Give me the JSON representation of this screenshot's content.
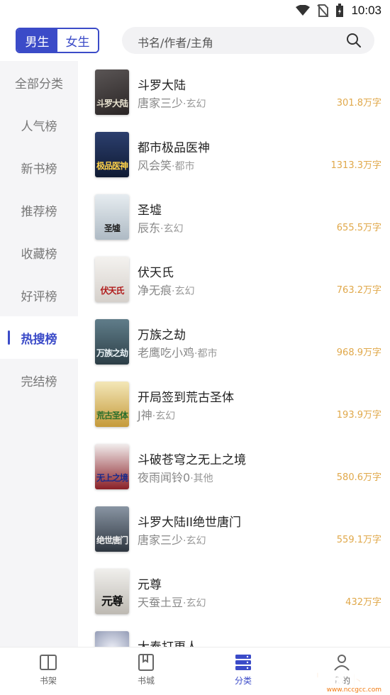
{
  "status_bar": {
    "time": "10:03",
    "icons": [
      "wifi-icon",
      "no-sim-icon",
      "battery-charging-icon"
    ]
  },
  "header": {
    "gender_tabs": [
      {
        "label": "男生",
        "active": true
      },
      {
        "label": "女生",
        "active": false
      }
    ],
    "search": {
      "placeholder": "书名/作者/主角",
      "icon": "search-icon"
    }
  },
  "sidebar": {
    "items": [
      {
        "label": "全部分类",
        "active": false
      },
      {
        "label": "人气榜",
        "active": false
      },
      {
        "label": "新书榜",
        "active": false
      },
      {
        "label": "推荐榜",
        "active": false
      },
      {
        "label": "收藏榜",
        "active": false
      },
      {
        "label": "好评榜",
        "active": false
      },
      {
        "label": "热搜榜",
        "active": true
      },
      {
        "label": "完结榜",
        "active": false
      }
    ]
  },
  "books": [
    {
      "title": "斗罗大陆",
      "author": "唐家三少",
      "sep": "·",
      "genre": "玄幻",
      "count": "301.8万字",
      "cover_text": "斗罗大陆",
      "cover_color": "#3d3a3a"
    },
    {
      "title": "都市极品医神",
      "author": "风会笑",
      "sep": "·",
      "genre": "都市",
      "count": "1313.3万字",
      "cover_text": "极品医神",
      "cover_color": "#1d2c52"
    },
    {
      "title": "圣墟",
      "author": "辰东",
      "sep": "·",
      "genre": "玄幻",
      "count": "655.5万字",
      "cover_text": "圣墟",
      "cover_color": "#c9d3da"
    },
    {
      "title": "伏天氏",
      "author": "净无痕",
      "sep": "·",
      "genre": "玄幻",
      "count": "763.2万字",
      "cover_text": "伏天氏",
      "cover_color": "#e9e6e3"
    },
    {
      "title": "万族之劫",
      "author": "老鹰吃小鸡",
      "sep": "·",
      "genre": "都市",
      "count": "968.9万字",
      "cover_text": "万族之劫",
      "cover_color": "#3f5a66"
    },
    {
      "title": "开局签到荒古圣体",
      "author": "J神",
      "sep": "·",
      "genre": "玄幻",
      "count": "193.9万字",
      "cover_text": "荒古圣体",
      "cover_color": "#c59a3a"
    },
    {
      "title": "斗破苍穹之无上之境",
      "author": "夜雨闻铃0",
      "sep": "·",
      "genre": "其他",
      "count": "580.6万字",
      "cover_text": "无上之境",
      "cover_color": "#7c1e24"
    },
    {
      "title": "斗罗大陆II绝世唐门",
      "author": "唐家三少",
      "sep": "·",
      "genre": "玄幻",
      "count": "559.1万字",
      "cover_text": "绝世唐门",
      "cover_color": "#4a5564"
    },
    {
      "title": "元尊",
      "author": "天蚕土豆",
      "sep": "·",
      "genre": "玄幻",
      "count": "432万字",
      "cover_text": "元尊",
      "cover_color": "#d9d7d2"
    },
    {
      "title": "大奉打更人",
      "author": "",
      "sep": "",
      "genre": "",
      "count": "",
      "cover_text": "",
      "cover_color": "#9aa4bd"
    }
  ],
  "bottom_nav": {
    "items": [
      {
        "label": "书架",
        "icon": "bookshelf-icon",
        "active": false
      },
      {
        "label": "书城",
        "icon": "bookstore-icon",
        "active": false
      },
      {
        "label": "分类",
        "icon": "category-icon",
        "active": true
      },
      {
        "label": "我的",
        "icon": "profile-icon",
        "active": false
      }
    ]
  },
  "watermark": {
    "text": "南城下载",
    "sub": "www.nccgcc.com"
  },
  "colors": {
    "accent": "#3b4bc8",
    "count": "#e0a84a",
    "sidebar_bg": "#f5f5f7"
  }
}
